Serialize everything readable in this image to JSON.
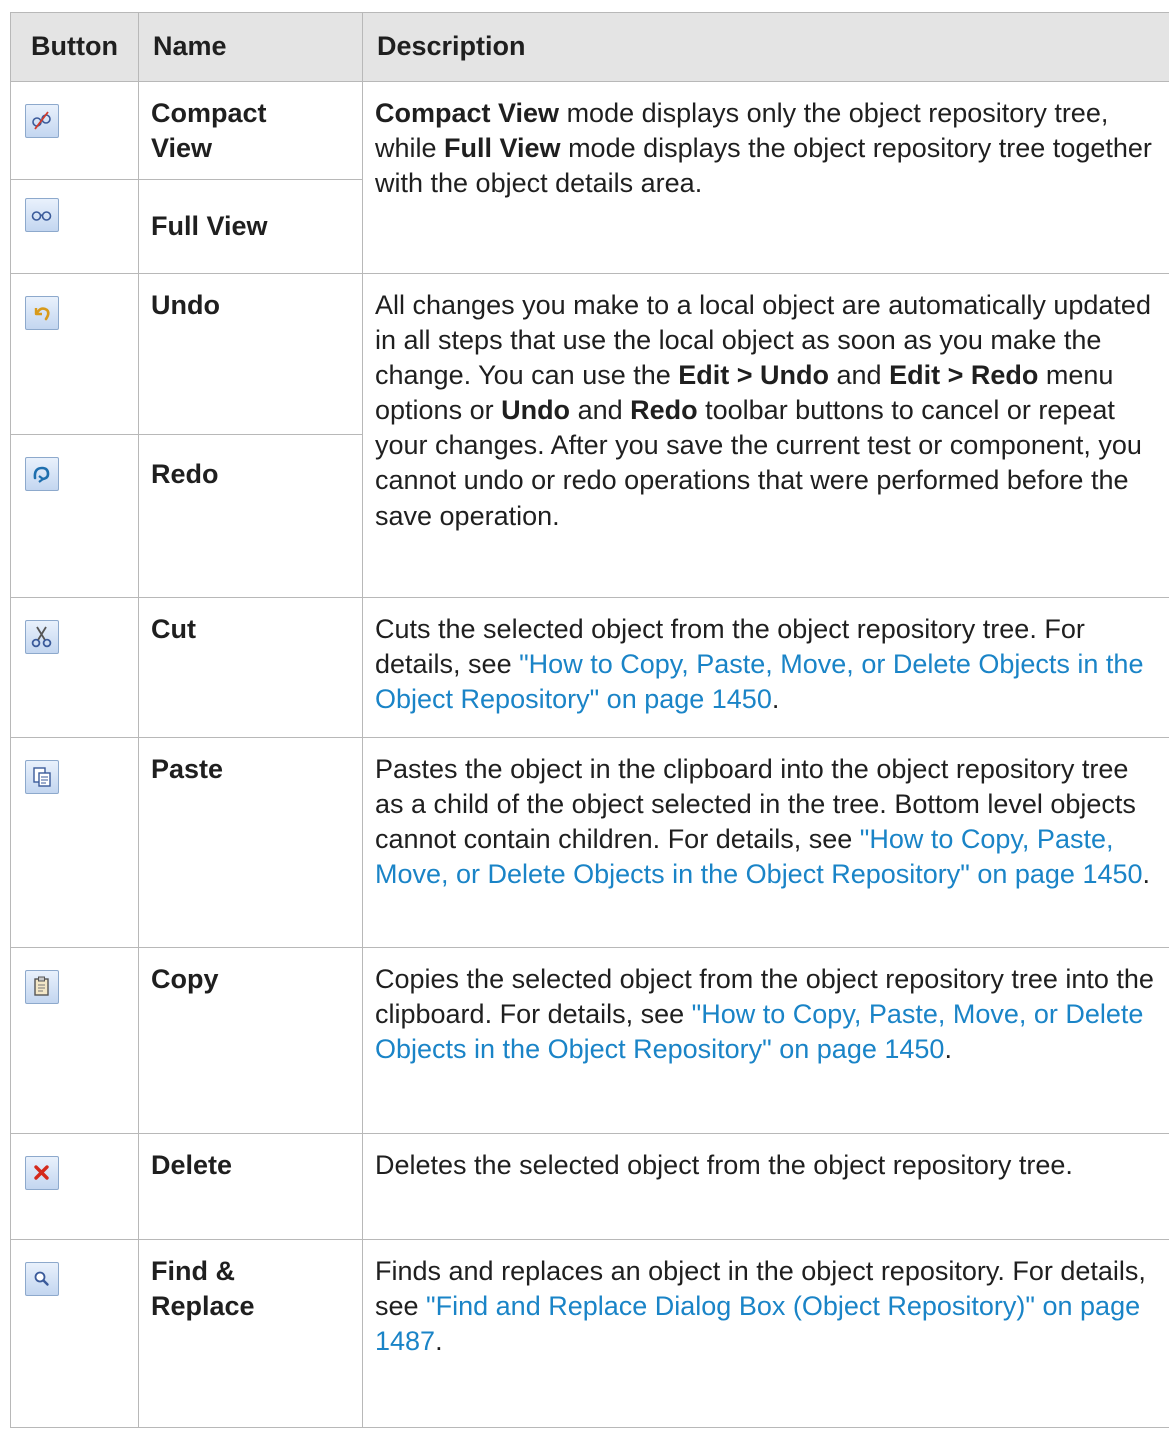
{
  "header": {
    "button": "Button",
    "name": "Name",
    "description": "Description"
  },
  "rows": {
    "compact": {
      "icon": "compact-view-icon",
      "name_line1": "Compact",
      "name_line2": "View"
    },
    "full": {
      "icon": "full-view-icon",
      "name": "Full View"
    },
    "view_desc": {
      "b1": "Compact View",
      "t1": " mode displays only the object repository tree, while ",
      "b2": "Full View",
      "t2": " mode displays the object repository tree together with the object details area."
    },
    "undo": {
      "icon": "undo-icon",
      "name": "Undo"
    },
    "redo": {
      "icon": "redo-icon",
      "name": "Redo"
    },
    "undo_desc": {
      "t1": "All changes you make to a local object are automatically updated in all steps that use the local object as soon as you make the change. You can use the ",
      "b1": "Edit > Undo",
      "t2": " and ",
      "b2": "Edit > Redo",
      "t3": " menu options or ",
      "b3": "Undo",
      "t4": " and ",
      "b4": "Redo",
      "t5": " toolbar buttons to cancel or repeat your changes. After you save the current test or component, you cannot undo or redo operations that were performed before the save operation."
    },
    "cut": {
      "icon": "cut-icon",
      "name": "Cut",
      "desc_text": "Cuts the selected object from the object repository tree. For details, see ",
      "link": "\"How to Copy, Paste, Move, or Delete Objects in the Object Repository\" on page 1450",
      "end": "."
    },
    "paste": {
      "icon": "paste-icon",
      "name": "Paste",
      "desc_text": "Pastes the object in the clipboard into the object repository tree as a child of the object selected in the tree. Bottom level objects cannot contain children. For details, see ",
      "link": "\"How to Copy, Paste, Move, or Delete Objects in the Object Repository\" on page 1450",
      "end": "."
    },
    "copy": {
      "icon": "copy-icon",
      "name": "Copy",
      "desc_text": "Copies the selected object from the object repository tree into the clipboard. For details, see ",
      "link": "\"How to Copy, Paste, Move, or Delete Objects in the Object Repository\" on page 1450",
      "end": "."
    },
    "delete": {
      "icon": "delete-icon",
      "name": "Delete",
      "desc_text": "Deletes the selected object from the object repository tree."
    },
    "find": {
      "icon": "find-replace-icon",
      "name_line1": "Find &",
      "name_line2": "Replace",
      "desc_text": "Finds and replaces an object in the object repository. For details, see ",
      "link": "\"Find and Replace Dialog Box (Object Repository)\" on page 1487",
      "end": "."
    }
  },
  "colors": {
    "link": "#1a84c7",
    "header_bg": "#e4e4e4",
    "border": "#b8b8b8"
  }
}
